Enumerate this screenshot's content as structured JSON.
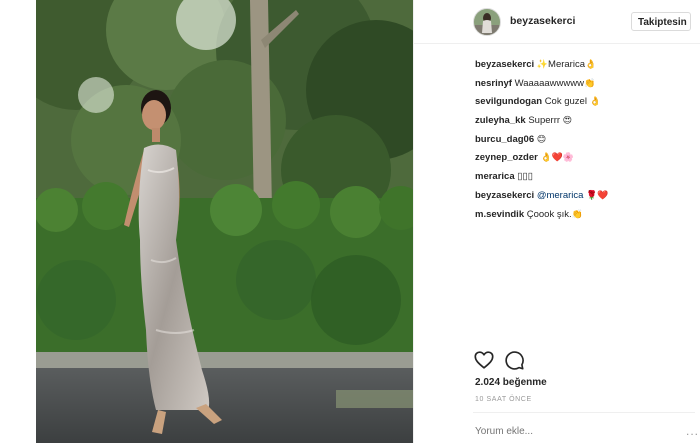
{
  "header": {
    "username": "beyzasekerci",
    "follow_label": "Takiptesin"
  },
  "comments": [
    {
      "user": "beyzasekerci",
      "text": "Merarica",
      "emoji_before": "✨",
      "emoji_after": "👌"
    },
    {
      "user": "nesrinyf",
      "text": "Waaaaawwwww",
      "emoji_after": "👏"
    },
    {
      "user": "sevilgundogan",
      "text": "Cok guzel",
      "emoji_after": "👌"
    },
    {
      "user": "zuleyha_kk",
      "text": "Superrr",
      "emoji_after": "😍"
    },
    {
      "user": "burcu_dag06",
      "text": "",
      "emoji_after": "😊"
    },
    {
      "user": "zeynep_ozder",
      "text": "",
      "emoji_after": "👌❤️🌸"
    },
    {
      "user": "merarica",
      "text": "▯▯▯"
    },
    {
      "user": "beyzasekerci",
      "mention": "@merarica",
      "emoji_after": "🌹❤️"
    },
    {
      "user": "m.sevindik",
      "text": "Çoook şık.",
      "emoji_after": "👏"
    }
  ],
  "actions": {
    "like_icon": "heart-icon",
    "comment_icon": "comment-bubble-icon"
  },
  "likes": "2.024 beğenme",
  "time": "10 SAAT ÖNCE",
  "comment_input": {
    "placeholder": "Yorum ekle..."
  },
  "more_label": "...",
  "colors": {
    "text": "#262626",
    "muted": "#999999",
    "border": "#efefef",
    "mention": "#003569"
  }
}
